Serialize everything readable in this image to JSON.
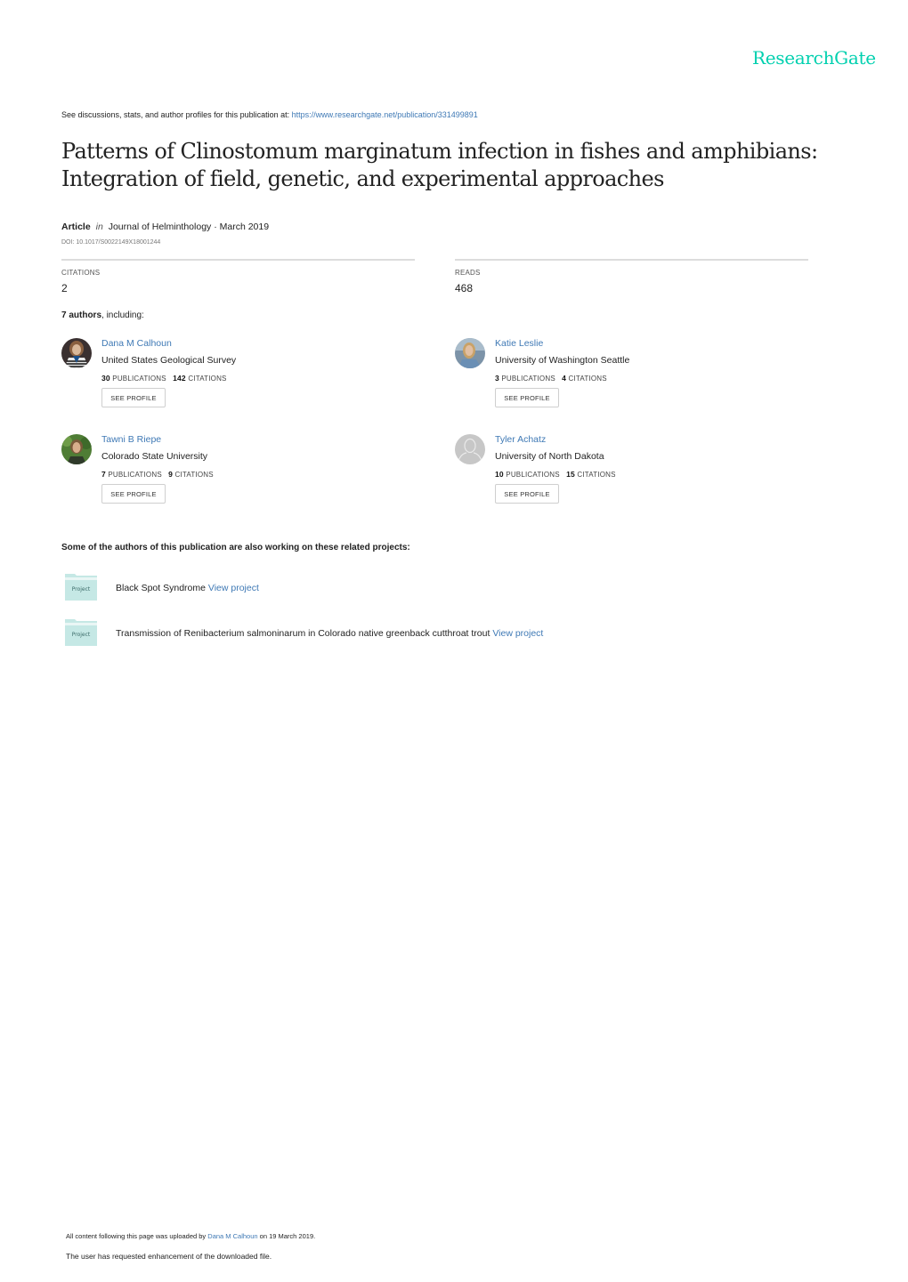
{
  "brand": {
    "name": "ResearchGate",
    "color": "#00d0af"
  },
  "discussion": {
    "prefix": "See discussions, stats, and author profiles for this publication at: ",
    "link": "https://www.researchgate.net/publication/331499891"
  },
  "publication": {
    "title_line1": "Patterns of Clinostomum marginatum infection in fishes and amphibians:",
    "title_line2": "Integration of field, genetic, and experimental approaches",
    "type": "Article",
    "in_label": "in",
    "journal_date": "Journal of Helminthology · March 2019",
    "doi": "DOI: 10.1017/S0022149X18001244"
  },
  "stats": {
    "citations_label": "CITATIONS",
    "citations_value": "2",
    "reads_label": "READS",
    "reads_value": "468"
  },
  "authors_header": {
    "count": "7 authors",
    "suffix": ", including:"
  },
  "authors": [
    {
      "name": "Dana M Calhoun",
      "institution": "United States Geological Survey",
      "publications": "30",
      "citations": "142",
      "button": "SEE PROFILE",
      "avatar": "photo"
    },
    {
      "name": "Katie Leslie",
      "institution": "University of Washington Seattle",
      "publications": "3",
      "citations": "4",
      "button": "SEE PROFILE",
      "avatar": "photo"
    },
    {
      "name": "Tawni B Riepe",
      "institution": "Colorado State University",
      "publications": "7",
      "citations": "9",
      "button": "SEE PROFILE",
      "avatar": "photo"
    },
    {
      "name": "Tyler Achatz",
      "institution": "University of North Dakota",
      "publications": "10",
      "citations": "15",
      "button": "SEE PROFILE",
      "avatar": "placeholder"
    }
  ],
  "labels": {
    "publications": "PUBLICATIONS",
    "citations": "CITATIONS"
  },
  "projects_header": "Some of the authors of this publication are also working on these related projects:",
  "projects": [
    {
      "title": "Black Spot Syndrome",
      "link": "View project",
      "icon_label": "Project"
    },
    {
      "title": "Transmission of Renibacterium salmoninarum in Colorado native greenback cutthroat trout",
      "link": "View project",
      "icon_label": "Project"
    }
  ],
  "footer": {
    "upload_prefix": "All content following this page was uploaded by ",
    "upload_user": "Dana M Calhoun",
    "upload_suffix": " on 19 March 2019.",
    "enhancement": "The user has requested enhancement of the downloaded file."
  }
}
